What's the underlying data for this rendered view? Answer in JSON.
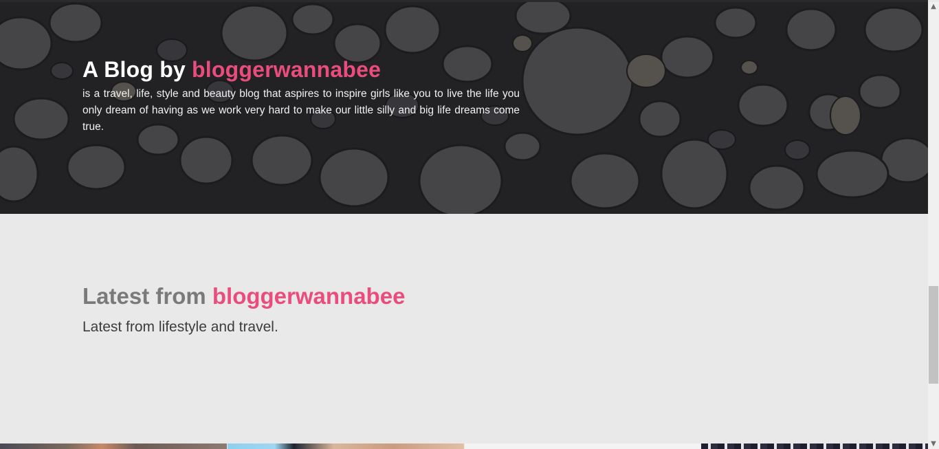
{
  "hero": {
    "title_prefix": "A Blog by",
    "title_highlight": "bloggerwannabee",
    "description": "is a travel, life, style and beauty blog that aspires to inspire girls like you to live the life you only dream of having as we work very hard to make our little silly and big life dreams come true."
  },
  "latest": {
    "title_prefix": "Latest from",
    "title_highlight": "bloggerwannabee",
    "subtitle": "Latest from lifestyle and travel."
  },
  "colors": {
    "accent": "#ea4c7d",
    "section_bg": "#e9e9e9",
    "hero_overlay": "#141416"
  },
  "scrollbar": {
    "up_icon": "chevron-up-icon",
    "down_icon": "chevron-down-icon"
  }
}
